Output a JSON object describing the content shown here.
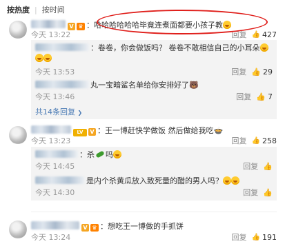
{
  "sort": {
    "active": "按热度",
    "other": "按时间"
  },
  "comments": [
    {
      "text": "哈哈哈哈哈哈毕竟连煮面都要小孩子教",
      "time": "今天 13:22",
      "reply": "回复",
      "likes": "427"
    },
    {
      "text": "王一博赶快学做饭 然后做给我吃",
      "time": "今天 13:23",
      "reply": "回复",
      "likes": "258",
      "badge": "LV"
    },
    {
      "text": "想吃王一博做的手抓饼",
      "time": "今天 13:24",
      "reply": "回复",
      "likes": "191"
    }
  ],
  "replies_block1": [
    {
      "text": "：卷卷，你会做饭吗？ 卷卷不敢相信自己的小耳朵",
      "time": "今天 13:53",
      "reply": "回复",
      "likes": "29"
    },
    {
      "text": "丸一宝暗鲨名单给你安排好了",
      "time": "今天 13:46",
      "reply": "回复",
      "likes": "7"
    }
  ],
  "more_replies": "共14条回复",
  "replies_block2": [
    {
      "text_prefix": "杀",
      "text_suffix": "吗",
      "time": "今天 14:45",
      "reply": "回复",
      "likes": ""
    },
    {
      "text": "是内个杀黄瓜放入致死量的醋的男人吗？",
      "time": "今天 14:30",
      "reply": "回复",
      "likes": ""
    }
  ]
}
